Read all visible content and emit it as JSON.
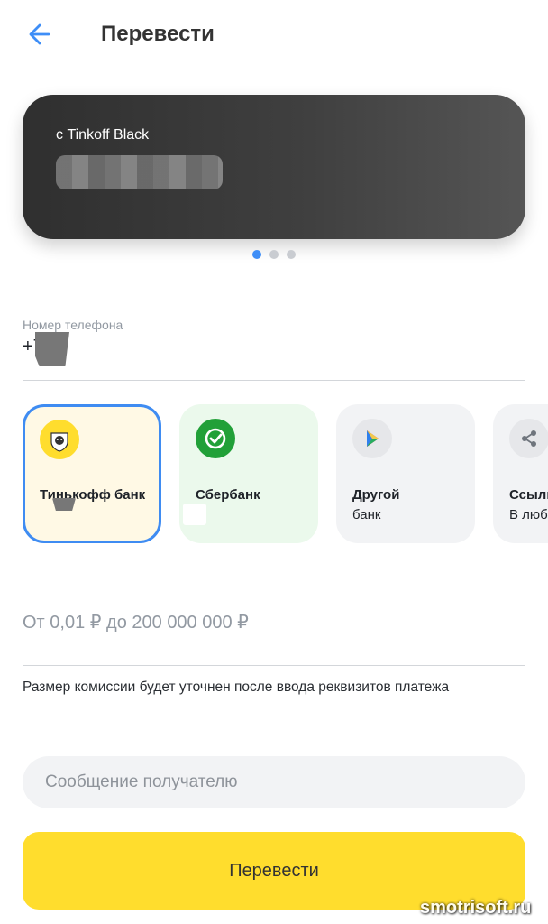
{
  "header": {
    "title": "Перевести",
    "back_icon": "arrow-left-icon"
  },
  "card": {
    "name": "с Tinkoff Black",
    "page_indicator": {
      "count": 3,
      "active": 1
    }
  },
  "phone": {
    "label": "Номер телефона",
    "value_prefix": "+7"
  },
  "banks": [
    {
      "name": "Тинькофф банк",
      "sub": "",
      "icon": "tinkoff-logo-icon",
      "selected": true
    },
    {
      "name": "Сбербанк",
      "sub": "",
      "icon": "sber-check-icon",
      "selected": false
    },
    {
      "name": "Другой",
      "sub": "банк",
      "icon": "bank-transfer-icon",
      "selected": false
    },
    {
      "name": "Ссылк",
      "sub": "В любо",
      "icon": "share-icon",
      "selected": false
    }
  ],
  "amount": {
    "placeholder": "От 0,01 ₽ до 200 000 000 ₽"
  },
  "commission_note": "Размер комиссии будет уточнен после ввода реквизитов платежа",
  "message": {
    "placeholder": "Сообщение получателю"
  },
  "submit": {
    "label": "Перевести"
  },
  "watermark": "smotrisoft.ru",
  "colors": {
    "accent": "#3e8ef7",
    "button": "#ffdd2d",
    "tinkoff": "#ffdd2d",
    "sber": "#21a038"
  }
}
